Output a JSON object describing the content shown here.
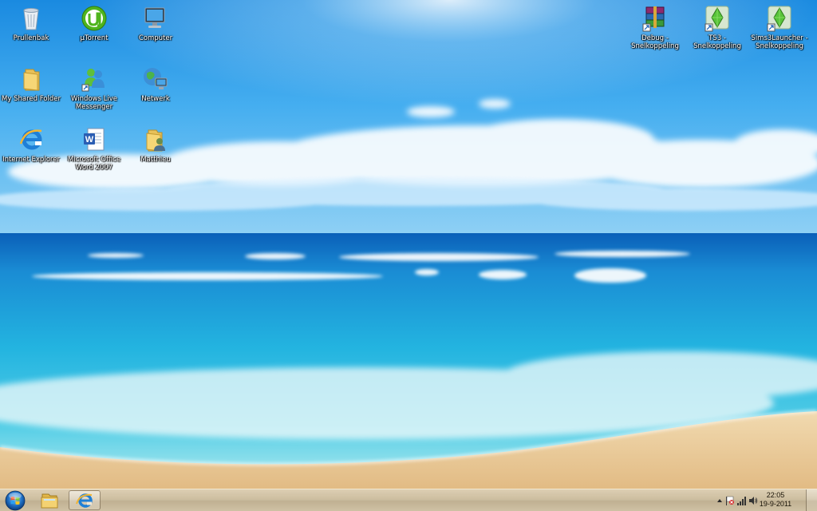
{
  "desktop": {
    "icons": [
      {
        "id": "recycle-bin",
        "label": "Prullenbak",
        "icon": "recycle-bin-icon"
      },
      {
        "id": "utorrent",
        "label": "µTorrent",
        "icon": "utorrent-icon"
      },
      {
        "id": "computer",
        "label": "Computer",
        "icon": "computer-icon"
      },
      {
        "id": "my-shared-folder",
        "label": "My Shared Folder",
        "icon": "folder-icon"
      },
      {
        "id": "windows-live-messenger",
        "label": "Windows Live\nMessenger",
        "icon": "messenger-icon"
      },
      {
        "id": "netwerk",
        "label": "Netwerk",
        "icon": "network-globe-icon"
      },
      {
        "id": "internet-explorer",
        "label": "Internet Explorer",
        "icon": "internet-explorer-icon"
      },
      {
        "id": "word-2007",
        "label": "Microsoft Office\nWord 2007",
        "icon": "word-icon"
      },
      {
        "id": "matthieu",
        "label": "Matthieu",
        "icon": "user-folder-icon"
      },
      {
        "id": "debug",
        "label": "Debug -\nSnelkoppeling",
        "icon": "winrar-archive-icon"
      },
      {
        "id": "ts3",
        "label": "TS3 - Snelkoppeling",
        "icon": "sims-plumbob-icon"
      },
      {
        "id": "sims3launcher",
        "label": "Sims3Launcher -\nSnelkoppeling",
        "icon": "sims-plumbob-icon"
      }
    ]
  },
  "taskbar": {
    "start": "start-orb-icon",
    "pinned": [
      {
        "id": "explorer",
        "icon": "explorer-folder-icon",
        "active": false
      },
      {
        "id": "ie",
        "icon": "internet-explorer-icon",
        "active": true
      }
    ],
    "tray": {
      "icons": [
        "show-hidden-icons-chevron",
        "action-center-flag-icon",
        "network-signal-icon",
        "volume-icon"
      ],
      "time": "22:05",
      "date": "19-9-2011"
    }
  },
  "colors": {
    "taskbar": "#c7b694",
    "sky_top": "#0e7fd8",
    "sea": "#1aa6d6",
    "sand": "#e9c690"
  }
}
